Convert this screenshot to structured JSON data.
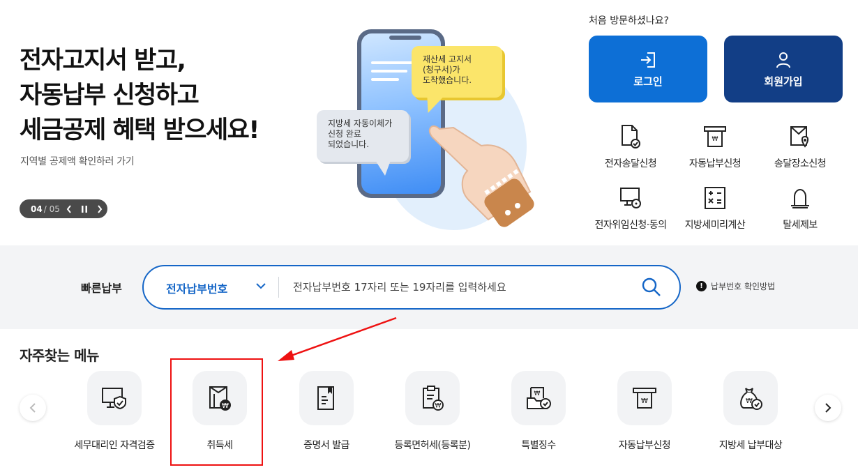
{
  "hero": {
    "title_lines": [
      "전자고지서 받고,",
      "자동납부 신청하고",
      "세금공제 혜택 받으세요!"
    ],
    "subtitle": "지역별 공제액 확인하러 가기",
    "pager_current": "04",
    "pager_total": "05",
    "bubble_yellow": [
      "재산세 고지서",
      "(청구서)가",
      "도착했습니다."
    ],
    "bubble_gray": [
      "지방세 자동이체가",
      "신청 완료",
      "되었습니다."
    ]
  },
  "account": {
    "first_visit": "처음 방문하셨나요?",
    "login_label": "로그인",
    "join_label": "회원가입"
  },
  "quick_services": [
    {
      "label": "전자송달신청",
      "icon": "e-delivery-icon"
    },
    {
      "label": "자동납부신청",
      "icon": "auto-pay-icon"
    },
    {
      "label": "송달장소신청",
      "icon": "delivery-place-icon"
    },
    {
      "label": "전자위임신청·동의",
      "icon": "e-delegation-icon"
    },
    {
      "label": "지방세미리계산",
      "icon": "calculator-icon"
    },
    {
      "label": "탈세제보",
      "icon": "alarm-bell-icon"
    }
  ],
  "fast_pay": {
    "label": "빠른납부",
    "select_value": "전자납부번호",
    "placeholder": "전자납부번호 17자리 또는 19자리를 입력하세요",
    "help_text": "납부번호 확인방법"
  },
  "frequent": {
    "title": "자주찾는 메뉴",
    "items": [
      {
        "label": "세무대리인 자격검증",
        "icon": "monitor-shield-icon"
      },
      {
        "label": "취득세",
        "icon": "acquisition-tax-icon"
      },
      {
        "label": "증명서 발급",
        "icon": "certificate-icon"
      },
      {
        "label": "등록면허세(등록분)",
        "icon": "registration-tax-icon"
      },
      {
        "label": "특별징수",
        "icon": "special-collection-icon"
      },
      {
        "label": "자동납부신청",
        "icon": "auto-pay-icon"
      },
      {
        "label": "지방세 납부대상",
        "icon": "money-bag-icon"
      }
    ]
  },
  "colors": {
    "primary": "#0d6fd6",
    "navy": "#123e86",
    "search_border": "#1566c7",
    "highlight": "#ee1111"
  }
}
